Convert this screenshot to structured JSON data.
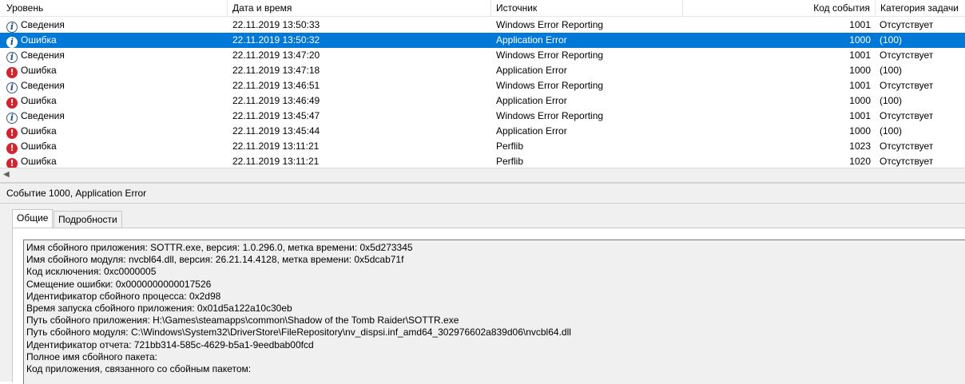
{
  "columns": {
    "level": "Уровень",
    "date": "Дата и время",
    "source": "Источник",
    "event_id": "Код события",
    "category": "Категория задачи"
  },
  "rows": [
    {
      "level": "Сведения",
      "type": "info",
      "date": "22.11.2019 13:50:33",
      "source": "Windows Error Reporting",
      "event_id": "1001",
      "category": "Отсутствует",
      "selected": false
    },
    {
      "level": "Ошибка",
      "type": "info",
      "date": "22.11.2019 13:50:32",
      "source": "Application Error",
      "event_id": "1000",
      "category": "(100)",
      "selected": true
    },
    {
      "level": "Сведения",
      "type": "info",
      "date": "22.11.2019 13:47:20",
      "source": "Windows Error Reporting",
      "event_id": "1001",
      "category": "Отсутствует",
      "selected": false
    },
    {
      "level": "Ошибка",
      "type": "error",
      "date": "22.11.2019 13:47:18",
      "source": "Application Error",
      "event_id": "1000",
      "category": "(100)",
      "selected": false
    },
    {
      "level": "Сведения",
      "type": "info",
      "date": "22.11.2019 13:46:51",
      "source": "Windows Error Reporting",
      "event_id": "1001",
      "category": "Отсутствует",
      "selected": false
    },
    {
      "level": "Ошибка",
      "type": "error",
      "date": "22.11.2019 13:46:49",
      "source": "Application Error",
      "event_id": "1000",
      "category": "(100)",
      "selected": false
    },
    {
      "level": "Сведения",
      "type": "info",
      "date": "22.11.2019 13:45:47",
      "source": "Windows Error Reporting",
      "event_id": "1001",
      "category": "Отсутствует",
      "selected": false
    },
    {
      "level": "Ошибка",
      "type": "error",
      "date": "22.11.2019 13:45:44",
      "source": "Application Error",
      "event_id": "1000",
      "category": "(100)",
      "selected": false
    },
    {
      "level": "Ошибка",
      "type": "error",
      "date": "22.11.2019 13:11:21",
      "source": "Perflib",
      "event_id": "1023",
      "category": "Отсутствует",
      "selected": false
    },
    {
      "level": "Ошибка",
      "type": "error",
      "date": "22.11.2019 13:11:21",
      "source": "Perflib",
      "event_id": "1020",
      "category": "Отсутствует",
      "selected": false
    }
  ],
  "details": {
    "title": "Событие 1000, Application Error",
    "tabs": [
      "Общие",
      "Подробности"
    ],
    "lines": [
      "Имя сбойного приложения: SOTTR.exe, версия: 1.0.296.0, метка времени: 0x5d273345",
      "Имя сбойного модуля: nvcbl64.dll, версия: 26.21.14.4128, метка времени: 0x5dcab71f",
      "Код исключения: 0xc0000005",
      "Смещение ошибки: 0x0000000000017526",
      "Идентификатор сбойного процесса: 0x2d98",
      "Время запуска сбойного приложения: 0x01d5a122a10c30eb",
      "Путь сбойного приложения: H:\\Games\\steamapps\\common\\Shadow of the Tomb Raider\\SOTTR.exe",
      "Путь сбойного модуля: C:\\Windows\\System32\\DriverStore\\FileRepository\\nv_dispsi.inf_amd64_302976602a839d06\\nvcbl64.dll",
      "Идентификатор отчета: 721bb314-585c-4629-b5a1-9eedbab00fcd",
      "Полное имя сбойного пакета:",
      "Код приложения, связанного со сбойным пакетом:"
    ]
  },
  "icons": {
    "info": "info-icon",
    "error": "error-icon",
    "scroll_left": "scroll-left-arrow-icon"
  },
  "colors": {
    "selection": "#0078d7",
    "error": "#d6232c",
    "info_border": "#3a5a8c",
    "pane_bg": "#f0f0f0"
  }
}
